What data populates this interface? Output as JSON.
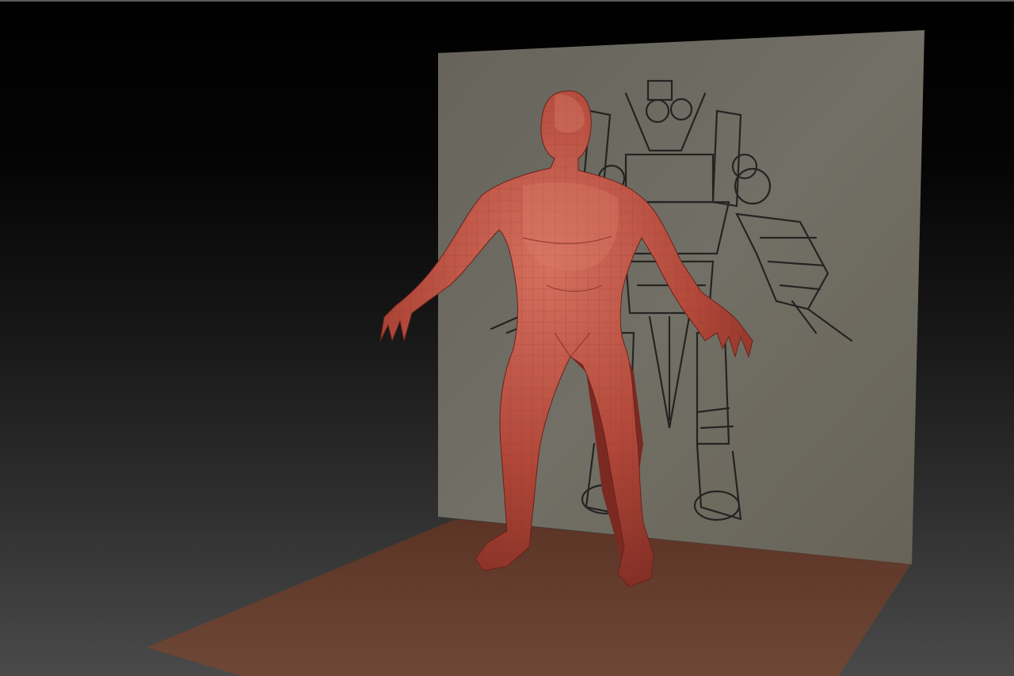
{
  "viewport": {
    "background_top": "#000000",
    "background_bottom": "#4a4a4a"
  },
  "scene": {
    "mesh_color": "#b44a3c",
    "mesh_highlight": "#d9705e",
    "mesh_shadow": "#6e241c",
    "backdrop_color": "#7b786d",
    "floor_color": "#6a3e2e",
    "sketch_color": "#1e1e1e"
  },
  "icons": [
    "base-mesh-figure",
    "concept-sketch-plane",
    "floor-plane"
  ]
}
